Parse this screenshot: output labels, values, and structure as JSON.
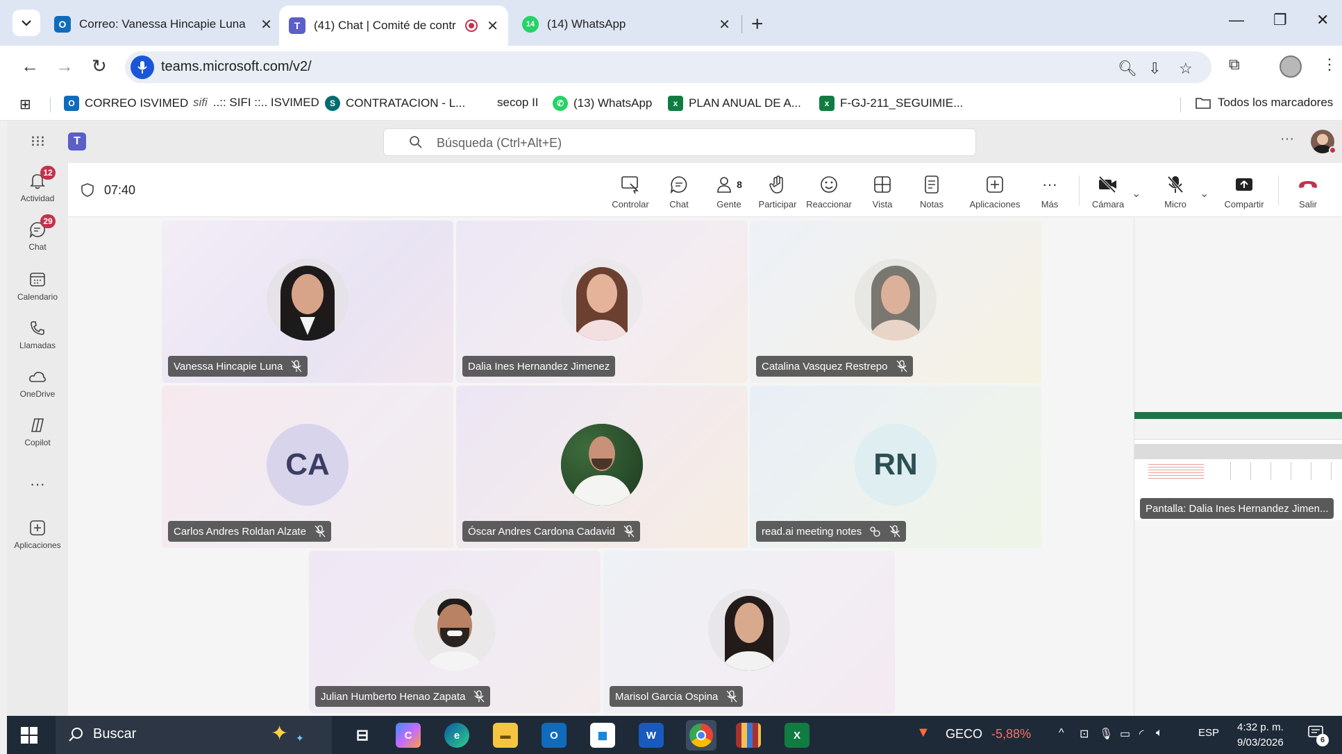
{
  "browser": {
    "tabs": [
      {
        "title": "Correo: Vanessa Hincapie Luna"
      },
      {
        "title": "(41) Chat | Comité de contr"
      },
      {
        "title": "(14) WhatsApp",
        "badge": "14"
      }
    ],
    "url": "teams.microsoft.com/v2/",
    "bookmarks": [
      {
        "label": "CORREO ISVIMED"
      },
      {
        "label": "..:: SIFI ::.. ISVIMED"
      },
      {
        "label": "CONTRATACION - L..."
      },
      {
        "label": "secop II"
      },
      {
        "label": "(13) WhatsApp"
      },
      {
        "label": "PLAN ANUAL DE A..."
      },
      {
        "label": "F-GJ-211_SEGUIMIE..."
      }
    ],
    "all_bookmarks": "Todos los marcadores"
  },
  "teams": {
    "search_placeholder": "Búsqueda (Ctrl+Alt+E)",
    "rail": [
      {
        "label": "Actividad",
        "badge": "12",
        "icon": "bell-icon"
      },
      {
        "label": "Chat",
        "badge": "29",
        "icon": "chat-icon"
      },
      {
        "label": "Calendario",
        "icon": "calendar-icon"
      },
      {
        "label": "Llamadas",
        "icon": "phone-icon"
      },
      {
        "label": "OneDrive",
        "icon": "cloud-icon"
      },
      {
        "label": "Copilot",
        "icon": "copilot-icon"
      },
      {
        "label": "Aplicaciones",
        "icon": "add-app-icon"
      }
    ],
    "meeting": {
      "timer": "07:40",
      "people_count": "8",
      "controls": [
        {
          "label": "Controlar"
        },
        {
          "label": "Chat"
        },
        {
          "label": "Gente"
        },
        {
          "label": "Participar"
        },
        {
          "label": "Reaccionar"
        },
        {
          "label": "Vista"
        },
        {
          "label": "Notas"
        },
        {
          "label": "Aplicaciones"
        },
        {
          "label": "Más"
        },
        {
          "label": "Cámara"
        },
        {
          "label": "Micro"
        },
        {
          "label": "Compartir"
        },
        {
          "label": "Salir"
        }
      ]
    },
    "participants": [
      {
        "name": "Vanessa Hincapie Luna",
        "muted": true
      },
      {
        "name": "Dalia Ines Hernandez Jimenez",
        "muted": false
      },
      {
        "name": "Catalina Vasquez Restrepo",
        "muted": true
      },
      {
        "name": "Carlos Andres Roldan Alzate",
        "initials": "CA",
        "muted": true
      },
      {
        "name": "Óscar Andres Cardona Cadavid",
        "muted": true
      },
      {
        "name": "read.ai meeting notes",
        "initials": "RN",
        "muted": true
      },
      {
        "name": "Julian Humberto Henao Zapata",
        "muted": true
      },
      {
        "name": "Marisol Garcia Ospina",
        "muted": true
      }
    ],
    "screen_share_label": "Pantalla: Dalia Ines Hernandez Jimen..."
  },
  "taskbar": {
    "search": "Buscar",
    "stock_name": "GECO",
    "stock_change": "-5,88%",
    "language": "ESP",
    "time": "4:32 p. m.",
    "date": "9/03/2026",
    "notifications": "6"
  },
  "colors": {
    "teams_purple": "#5b5fc7",
    "leave_red": "#c4314b",
    "stock_red": "#ff6b6b"
  }
}
